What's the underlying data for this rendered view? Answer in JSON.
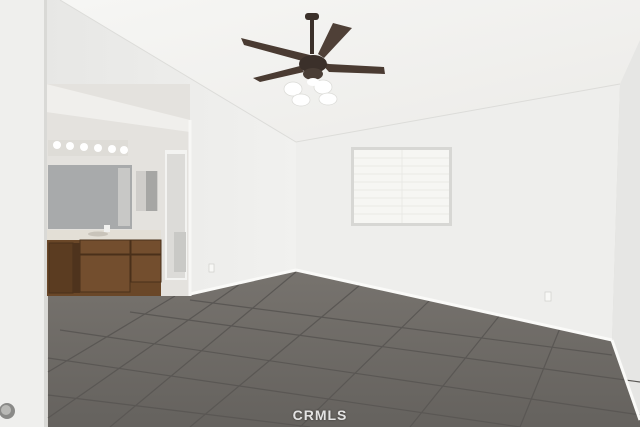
{
  "watermark": {
    "text": "CRMLS"
  },
  "colors": {
    "wall": "#eeeeec",
    "ceiling": "#f3f3f1",
    "floor_tile": "#6e6b67",
    "grout": "#5a5754",
    "cabinet": "#6a4728",
    "fan_body": "#3b302a",
    "window_glass": "#f6f6f3"
  },
  "icons": [
    "ceiling-fan-icon",
    "door-knob-icon",
    "vanity-light-icon"
  ]
}
